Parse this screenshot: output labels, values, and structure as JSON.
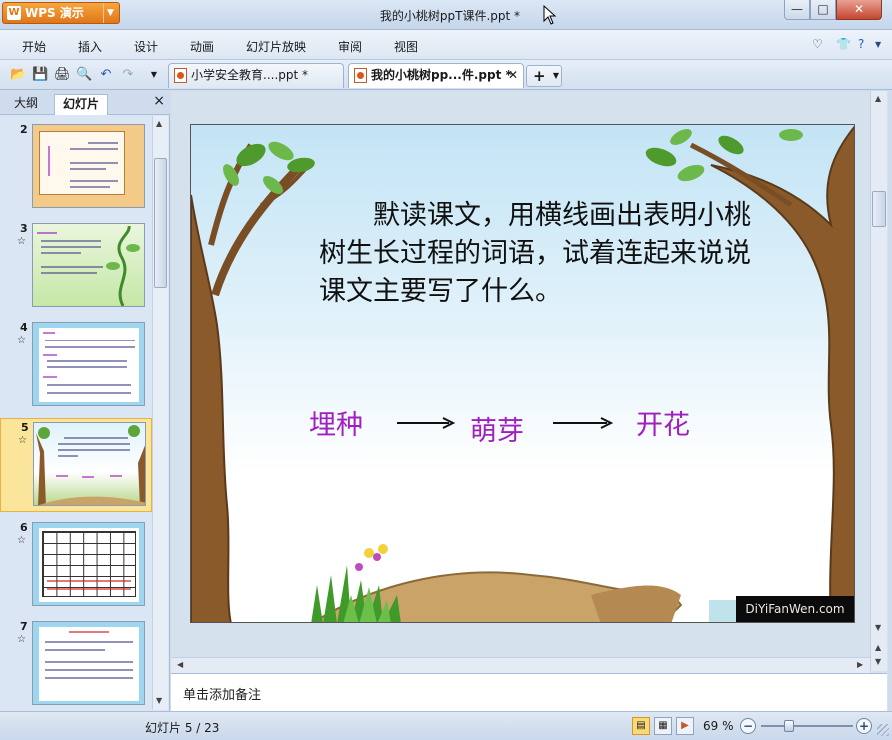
{
  "app": {
    "button_label": "WPS 演示",
    "logo_glyph": "W"
  },
  "window": {
    "title": "我的小桃树ppT课件.ppt *",
    "min": "—",
    "max": "□",
    "close": "✕"
  },
  "menu": {
    "items": [
      "开始",
      "插入",
      "设计",
      "动画",
      "幻灯片放映",
      "审阅",
      "视图"
    ],
    "right_icons": [
      "chevron-down-icon",
      "shirt-icon",
      "help-icon"
    ]
  },
  "tabs": [
    {
      "label": "小学安全教育....ppt *",
      "active": false
    },
    {
      "label": "我的小桃树pp...件.ppt *",
      "active": true
    }
  ],
  "left_panel": {
    "tab_outline": "大纲",
    "tab_slides": "幻灯片",
    "close": "×",
    "slides": [
      {
        "num": "2",
        "star": "",
        "selected": false
      },
      {
        "num": "3",
        "star": "☆",
        "selected": false
      },
      {
        "num": "4",
        "star": "☆",
        "selected": false
      },
      {
        "num": "5",
        "star": "☆",
        "selected": true
      },
      {
        "num": "6",
        "star": "☆",
        "selected": false
      },
      {
        "num": "7",
        "star": "☆",
        "selected": false
      }
    ]
  },
  "slide": {
    "text": "默读课文，用横线画出表明小桃树生长过程的词语，试着连起来说说课文主要写了什么。",
    "stages": [
      "埋种",
      "萌芽",
      "开花"
    ],
    "watermark": "DiYiFanWen.com",
    "colors": {
      "stage_text": "#9f1fbf",
      "trunk": "#8b5a2b",
      "leaf": "#4f9a2c",
      "ground": "#c9a368"
    }
  },
  "notes": {
    "placeholder": "单击添加备注"
  },
  "status": {
    "slide_position": "幻灯片 5 / 23",
    "zoom": "69 %",
    "zoom_out": "−",
    "zoom_in": "+"
  }
}
